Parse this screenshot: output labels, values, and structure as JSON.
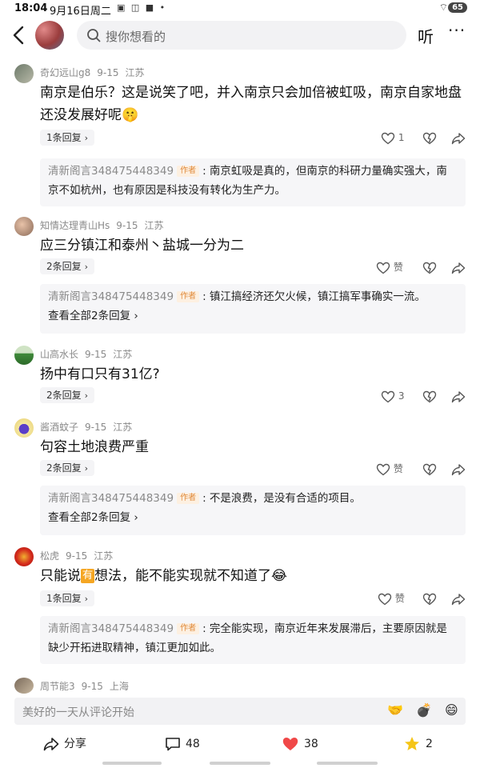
{
  "status": {
    "time": "18:04",
    "date": "9月16日周二",
    "battery": "65"
  },
  "topbar": {
    "search_placeholder": "搜你想看的",
    "listen_label": "听",
    "more_label": "···"
  },
  "comments": [
    {
      "user": "奇幻远山g8",
      "date": "9-15",
      "location": "江苏",
      "text": "南京是伯乐？这是说笑了吧，并入南京只会加倍被虹吸，南京自家地盘还没发展好呢",
      "replies_label": "1条回复",
      "likes": "1",
      "reply": {
        "name": "清新阁言348475448349",
        "tag": "作者",
        "text": ": 南京虹吸是真的，但南京的科研力量确实强大，南京不如杭州，也有原因是科技没有转化为生产力。"
      }
    },
    {
      "user": "知情达理青山Hs",
      "date": "9-15",
      "location": "江苏",
      "text": "应三分镇江和泰州丶盐城一分为二",
      "replies_label": "2条回复",
      "likes": "赞",
      "reply": {
        "name": "清新阁言348475448349",
        "tag": "作者",
        "text": ": 镇江搞经济还欠火候，镇江搞军事确实一流。"
      },
      "view_all": "查看全部2条回复"
    },
    {
      "user": "山高水长",
      "date": "9-15",
      "location": "江苏",
      "text": "扬中有口只有31亿?",
      "replies_label": "2条回复",
      "likes": "3"
    },
    {
      "user": "酱酒蚊子",
      "date": "9-15",
      "location": "江苏",
      "text": "句容土地浪费严重",
      "replies_label": "2条回复",
      "likes": "赞",
      "reply": {
        "name": "清新阁言348475448349",
        "tag": "作者",
        "text": ": 不是浪费，是没有合适的项目。"
      },
      "view_all": "查看全部2条回复"
    },
    {
      "user": "松虎",
      "date": "9-15",
      "location": "江苏",
      "text_a": "只能说",
      "text_emoji": "有",
      "text_b": "想法，能不能实现就不知道了",
      "replies_label": "1条回复",
      "likes": "赞",
      "reply": {
        "name": "清新阁言348475448349",
        "tag": "作者",
        "text": ": 完全能实现，南京近年来发展滞后，主要原因就是缺少开拓进取精神，镇江更加如此。"
      }
    },
    {
      "user": "周节能3",
      "date": "9-15",
      "location": "上海"
    }
  ],
  "input": {
    "placeholder": "美好的一天从评论开始"
  },
  "bottom": {
    "share_label": "分享",
    "comments_count": "48",
    "likes_count": "38",
    "favorites_count": "2"
  },
  "colors": {
    "heart": "#f04848",
    "star": "#f5c518",
    "author_tag": "#e08a3a"
  }
}
